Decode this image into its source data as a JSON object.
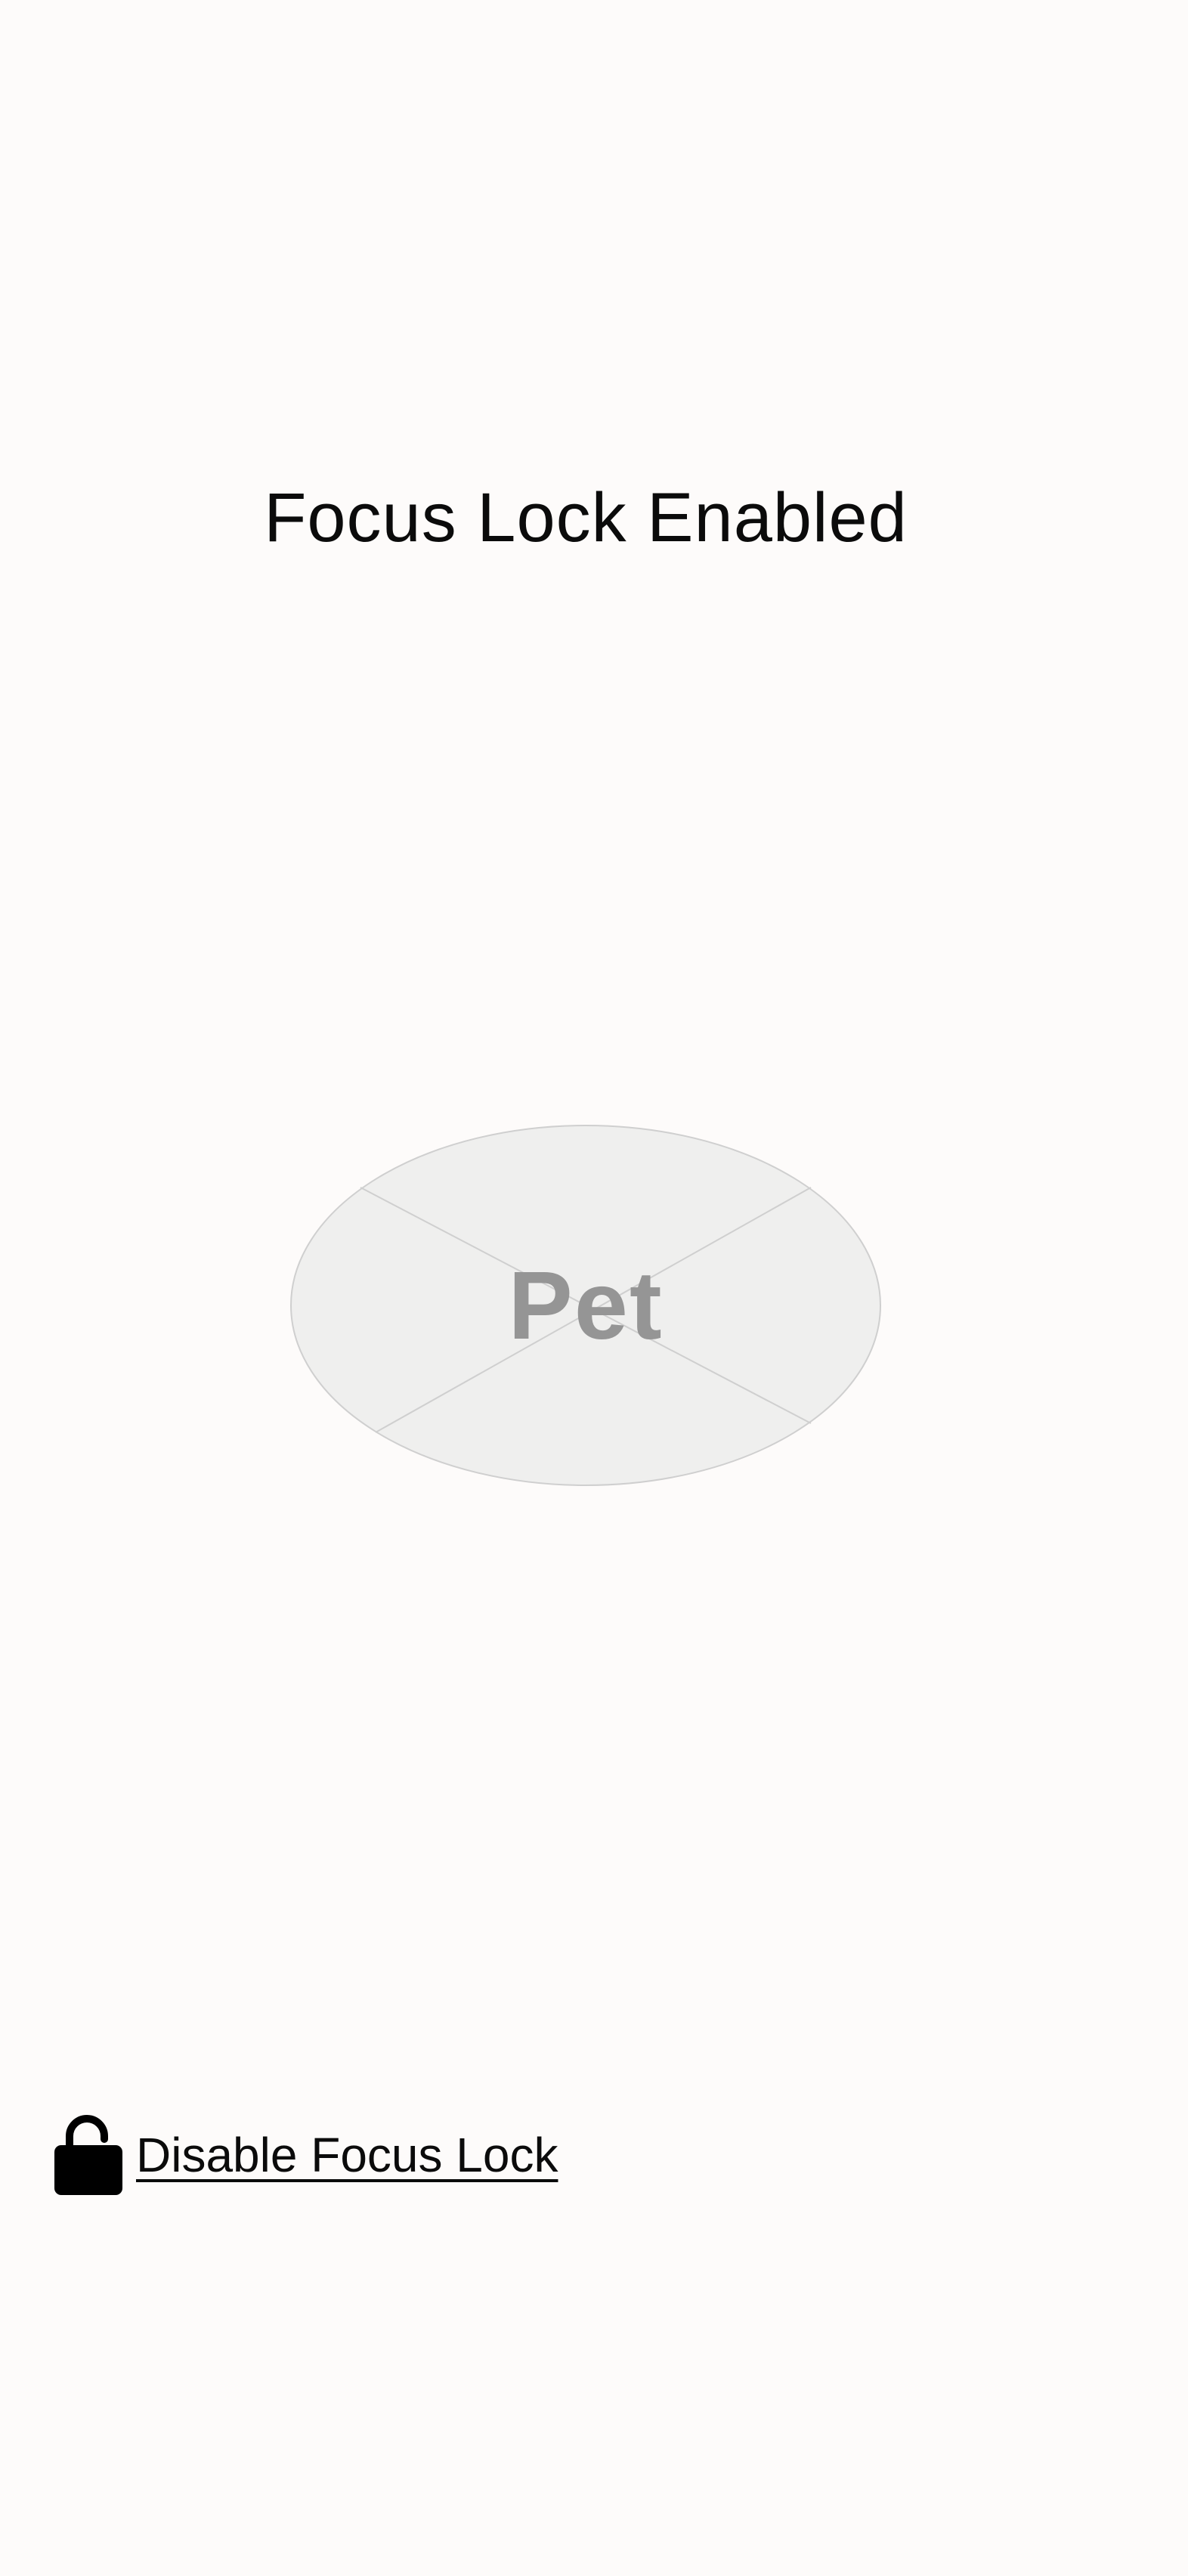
{
  "header": {
    "title": "Focus Lock Enabled"
  },
  "pet": {
    "label": "Pet",
    "fill_color": "#efefee",
    "stroke_color": "#cfcfcf",
    "text_color": "#959595"
  },
  "footer": {
    "disable_label": "Disable Focus Lock",
    "icon": "unlocked-padlock-icon"
  },
  "colors": {
    "background": "#fdfbfa",
    "text": "#0b0b0b"
  }
}
